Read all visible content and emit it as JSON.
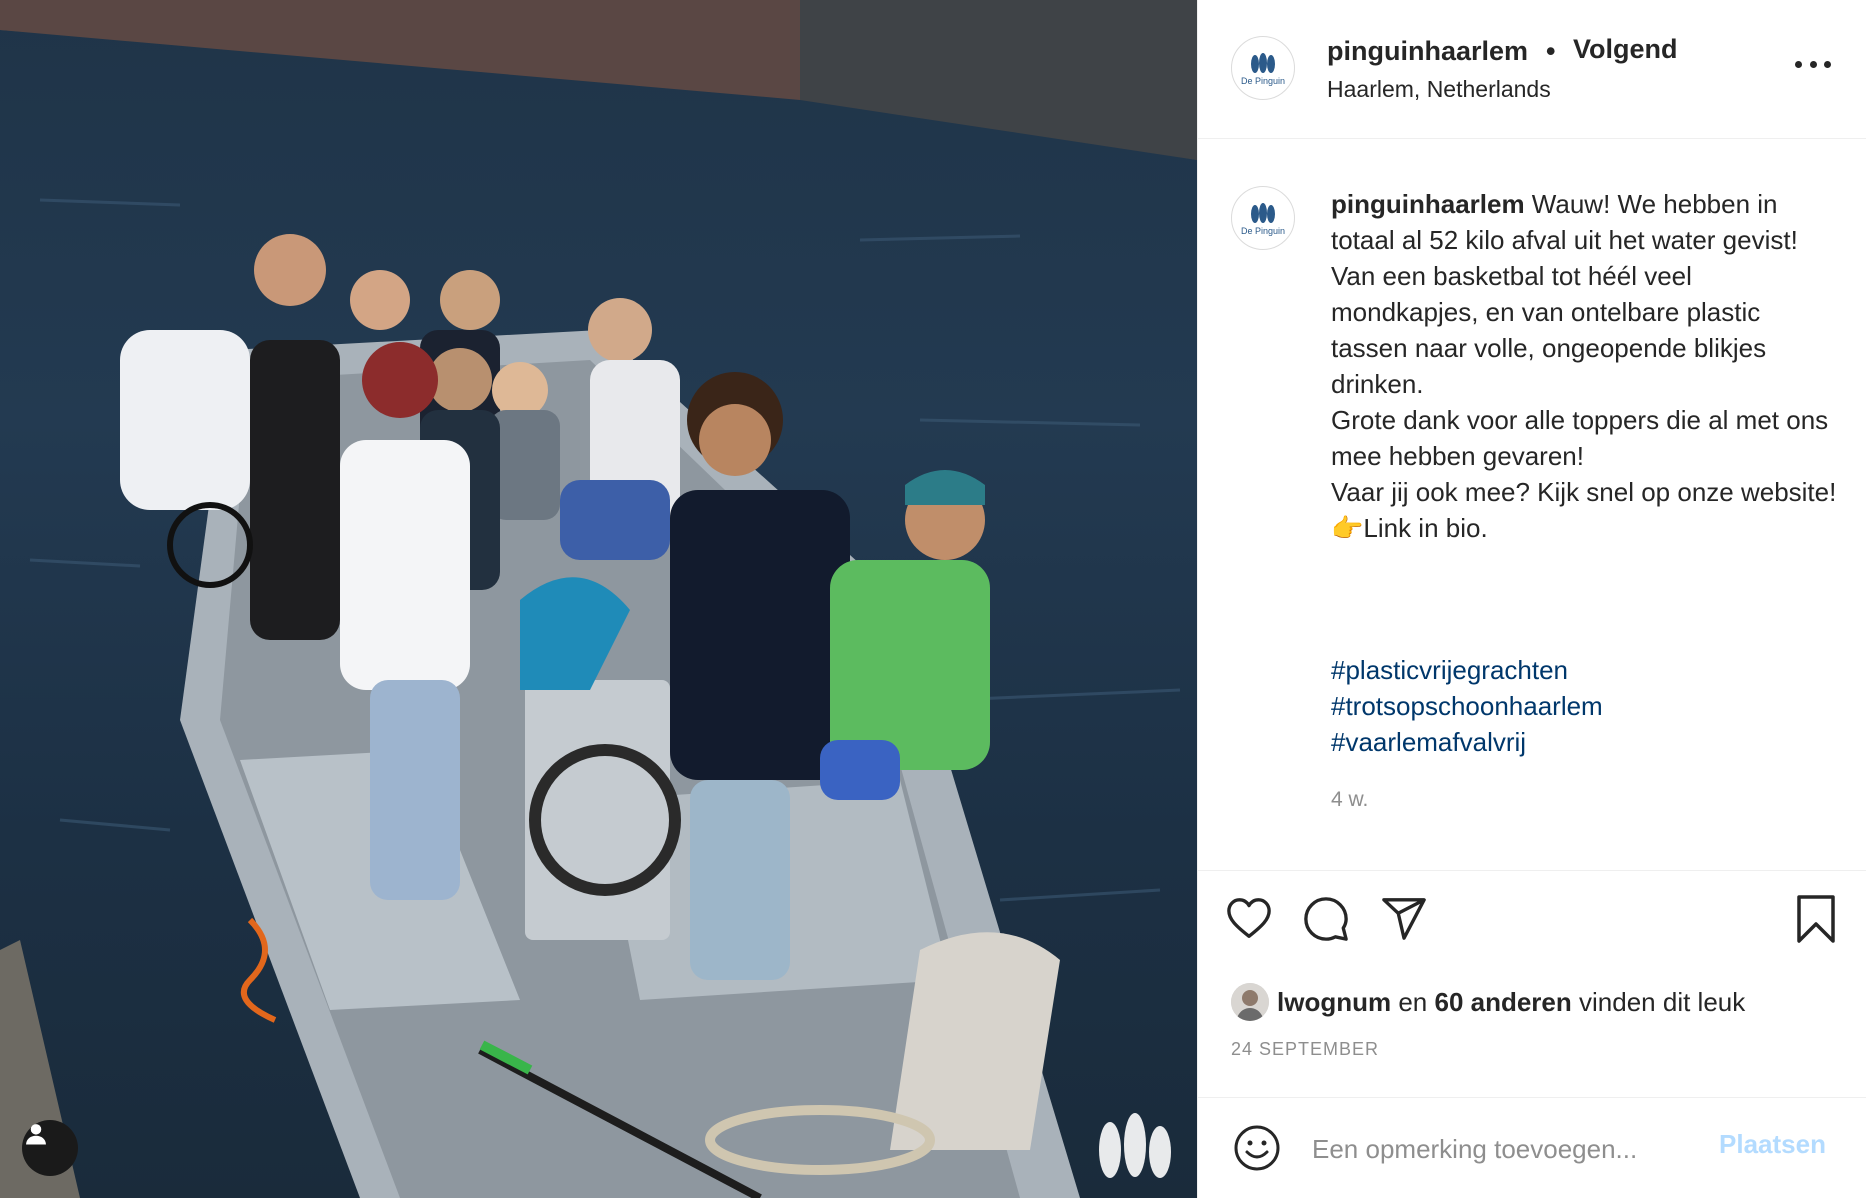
{
  "post": {
    "username": "pinguinhaarlem",
    "separator": "•",
    "follow_state": "Volgend",
    "location": "Haarlem, Netherlands",
    "avatar_label": "De Pinguin",
    "caption_username": "pinguinhaarlem",
    "caption_text": " Wauw! We hebben in totaal al 52 kilo afval uit het water gevist!\nVan een basketbal tot héél veel mondkapjes, en van ontelbare plastic tassen naar volle, ongeopende blikjes drinken.\nGrote dank voor alle toppers die al met ons mee hebben gevaren!\nVaar jij ook mee? Kijk snel op onze website!\n👉Link in bio.",
    "hashtags": [
      "#plasticvrijegrachten",
      "#trotsopschoonhaarlem",
      "#vaarlemafvalvrij"
    ],
    "time_ago": "4 w.",
    "likes": {
      "first_liker": "lwognum",
      "connector": "en",
      "others": "60 anderen",
      "suffix": "vinden dit leuk"
    },
    "date": "24 SEPTEMBER"
  },
  "comment": {
    "placeholder": "Een opmerking toevoegen...",
    "post_label": "Plaatsen"
  },
  "icons": {
    "more": "more-icon",
    "like": "heart-icon",
    "comment": "comment-icon",
    "share": "share-icon",
    "save": "bookmark-icon",
    "emoji": "emoji-icon",
    "user_tag": "user-icon"
  },
  "colors": {
    "hashtag": "#00376b",
    "muted": "#8e8e8e",
    "post_button_disabled": "#b3dbff"
  }
}
